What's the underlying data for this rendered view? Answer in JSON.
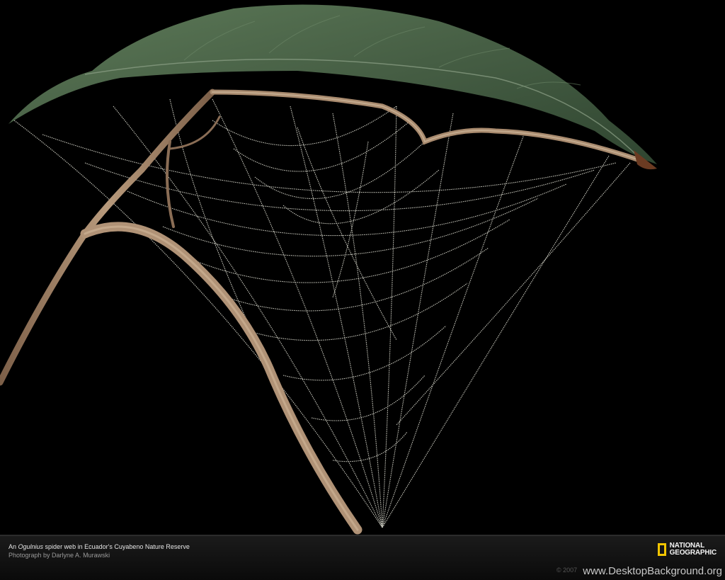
{
  "caption": {
    "prefix": "An ",
    "species": "Ogulnius",
    "suffix": " spider web in Ecuador's Cuyabeno Nature Reserve",
    "credit": "Photograph by Darlyne A. Murawski"
  },
  "brand": {
    "line1": "NATIONAL",
    "line2": "GEOGRAPHIC",
    "accent_color": "#f2c500"
  },
  "footer": {
    "copyright": "© 2007",
    "site_url": "www.DesktopBackground.org"
  },
  "photo": {
    "subject": "leaf-icon",
    "colors": {
      "leaf": "#4d6548",
      "stem": "#a98a6e",
      "web": "#dcdcd0",
      "background": "#000000"
    }
  }
}
